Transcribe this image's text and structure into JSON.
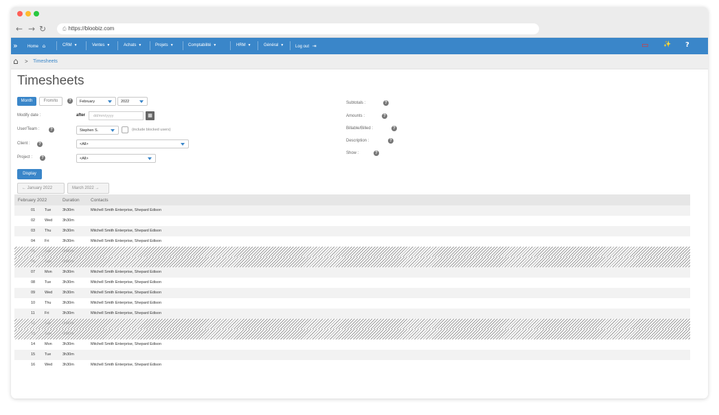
{
  "browser": {
    "url": "https://bloobiz.com",
    "back_icon": "←",
    "forward_icon": "→",
    "reload_icon": "↻",
    "lock_icon": "⎙"
  },
  "topnav": {
    "expand": "»",
    "items": [
      {
        "label": "Home",
        "icon": "⌂"
      },
      {
        "label": "CRM"
      },
      {
        "label": "Ventes"
      },
      {
        "label": "Achats"
      },
      {
        "label": "Projets"
      },
      {
        "label": "Comptabilité"
      },
      {
        "label": "HRM"
      },
      {
        "label": "Général"
      },
      {
        "label": "Log out",
        "icon": "⇥"
      }
    ],
    "caret": "▼",
    "right_icons": {
      "monitor": "▭",
      "wand": "✨",
      "help": "?"
    },
    "colors": {
      "bar": "#3a86c9",
      "monitor_icon": "#e3342f"
    }
  },
  "breadcrumb": {
    "home_icon": "⌂",
    "separator": ">",
    "current": "Timesheets"
  },
  "page": {
    "title": "Timesheets"
  },
  "filters": {
    "mode_month": "Month",
    "mode_fromto": "From/to",
    "help_glyph": "?",
    "month_value": "February",
    "year_value": "2022",
    "modify_date_label": "Modify date :",
    "after_label": "after",
    "date_placeholder": "dd/mm/yyyy",
    "calendar_icon": "▦",
    "user_team_label": "User/Team :",
    "user_value": "Stephen S.",
    "include_blocked_label": "(include blocked users)",
    "client_label": "Client :",
    "client_value": "<All>",
    "project_label": "Project :",
    "project_value": "<All>",
    "display_button": "Display",
    "subtotals_label": "Subtotals :",
    "amounts_label": "Amounts :",
    "billable_label": "Billable/Billed :",
    "description_label": "Description :",
    "show_label": "Show :"
  },
  "pagination": {
    "prev": "← January 2022",
    "next": "March 2022 →"
  },
  "table": {
    "headers": {
      "period": "February 2022",
      "duration": "Duration",
      "contacts": "Contacts"
    },
    "rows": [
      {
        "num": "01",
        "day": "Tue",
        "duration": "3h30m",
        "contacts": "Mitchell Smith Enterprise, Shepard Edison",
        "weekend": false
      },
      {
        "num": "02",
        "day": "Wed",
        "duration": "3h30m",
        "contacts": "",
        "weekend": false
      },
      {
        "num": "03",
        "day": "Thu",
        "duration": "3h30m",
        "contacts": "Mitchell Smith Enterprise, Shepard Edison",
        "weekend": false
      },
      {
        "num": "04",
        "day": "Fri",
        "duration": "3h30m",
        "contacts": "Mitchell Smith Enterprise, Shepard Edison",
        "weekend": false
      },
      {
        "num": "05",
        "day": "Sat",
        "duration": "0h00m",
        "contacts": "",
        "weekend": true
      },
      {
        "num": "06",
        "day": "Sun",
        "duration": "0h00m",
        "contacts": "",
        "weekend": true
      },
      {
        "num": "07",
        "day": "Mon",
        "duration": "3h30m",
        "contacts": "Mitchell Smith Enterprise, Shepard Edison",
        "weekend": false
      },
      {
        "num": "08",
        "day": "Tue",
        "duration": "3h30m",
        "contacts": "Mitchell Smith Enterprise, Shepard Edison",
        "weekend": false
      },
      {
        "num": "09",
        "day": "Wed",
        "duration": "3h30m",
        "contacts": "Mitchell Smith Enterprise, Shepard Edison",
        "weekend": false
      },
      {
        "num": "10",
        "day": "Thu",
        "duration": "3h30m",
        "contacts": "Mitchell Smith Enterprise, Shepard Edison",
        "weekend": false
      },
      {
        "num": "11",
        "day": "Fri",
        "duration": "3h30m",
        "contacts": "Mitchell Smith Enterprise, Shepard Edison",
        "weekend": false
      },
      {
        "num": "12",
        "day": "Sat",
        "duration": "0h00m",
        "contacts": "",
        "weekend": true
      },
      {
        "num": "13",
        "day": "Sun",
        "duration": "0h00m",
        "contacts": "",
        "weekend": true
      },
      {
        "num": "14",
        "day": "Mon",
        "duration": "3h30m",
        "contacts": "Mitchell Smith Enterprise, Shepard Edison",
        "weekend": false
      },
      {
        "num": "15",
        "day": "Tue",
        "duration": "3h30m",
        "contacts": "",
        "weekend": false
      },
      {
        "num": "16",
        "day": "Wed",
        "duration": "3h30m",
        "contacts": "Mitchell Smith Enterprise, Shepard Edison",
        "weekend": false
      }
    ]
  }
}
